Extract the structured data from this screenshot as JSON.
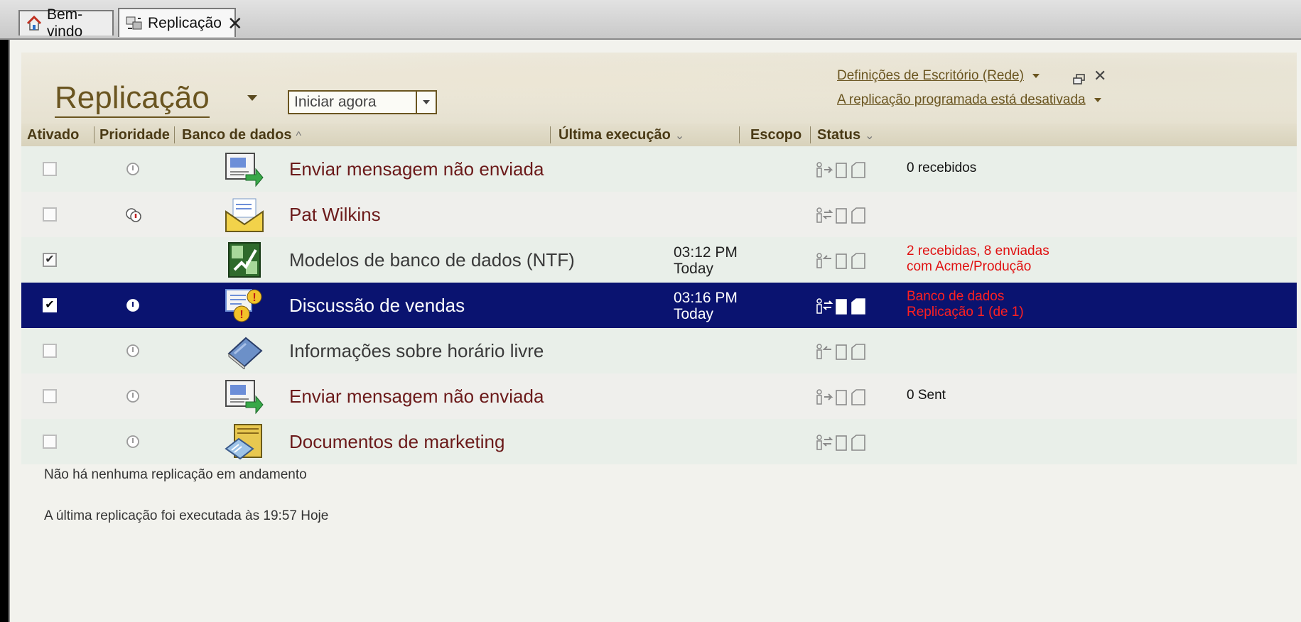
{
  "tabs": [
    {
      "label": "Bem-vindo",
      "icon": "home-icon",
      "active": false
    },
    {
      "label": "Replicação",
      "icon": "replication-icon",
      "active": true,
      "close": "✕"
    }
  ],
  "header": {
    "title": "Replicação",
    "start_button": "Iniciar agora",
    "location_link": "Definições de Escritório (Rede)",
    "schedule_link": "A replicação programada está desativada"
  },
  "columns": {
    "enabled": "Ativado",
    "priority": "Prioridade",
    "database": "Banco de dados",
    "last_run": "Última execução",
    "scope": "Escopo",
    "status": "Status"
  },
  "rows": [
    {
      "enabled": false,
      "priority": "medium",
      "icon": "outbox-icon",
      "name": "Enviar mensagem não enviada",
      "name_color": "#6b1a1a",
      "time": "",
      "day": "",
      "scope": "send",
      "status1": "0 recebidos",
      "status2": "",
      "status_color": "#111111"
    },
    {
      "enabled": false,
      "priority": "high",
      "icon": "mail-envelope-icon",
      "name": "Pat Wilkins",
      "name_color": "#6b1a1a",
      "time": "",
      "day": "",
      "scope": "both",
      "status1": "",
      "status2": "",
      "status_color": "#111111"
    },
    {
      "enabled": true,
      "priority": "none",
      "icon": "template-icon",
      "name": "Modelos de banco de dados (NTF)",
      "name_color": "#3a3a3a",
      "time": "03:12 PM",
      "day": "Today",
      "scope": "receive",
      "status1": "2 recebidas, 8 enviadas",
      "status2": "com Acme/Produção",
      "status_color": "#e01010"
    },
    {
      "enabled": true,
      "priority": "medium",
      "icon": "discussion-icon",
      "name": "Discussão de vendas",
      "name_color": "#ffffff",
      "time": "03:16 PM",
      "day": "Today",
      "scope": "both",
      "status1": "Banco de dados",
      "status2": "Replicação 1 (de 1)",
      "status_color": "#ff2020",
      "selected": true
    },
    {
      "enabled": false,
      "priority": "medium",
      "icon": "book-icon",
      "name": "Informações sobre horário livre",
      "name_color": "#3a3a3a",
      "time": "",
      "day": "",
      "scope": "receive",
      "status1": "",
      "status2": "",
      "status_color": "#111111"
    },
    {
      "enabled": false,
      "priority": "medium",
      "icon": "outbox-icon",
      "name": "Enviar mensagem não enviada",
      "name_color": "#6b1a1a",
      "time": "",
      "day": "",
      "scope": "send",
      "status1": "0 Sent",
      "status2": "",
      "status_color": "#111111"
    },
    {
      "enabled": false,
      "priority": "medium",
      "icon": "folder-doc-icon",
      "name": "Documentos de marketing",
      "name_color": "#6b1a1a",
      "time": "",
      "day": "",
      "scope": "both",
      "status1": "",
      "status2": "",
      "status_color": "#111111"
    }
  ],
  "footer": {
    "progress": "Não há nenhuma replicação em andamento",
    "last": "A última replicação foi executada às 19:57 Hoje"
  }
}
